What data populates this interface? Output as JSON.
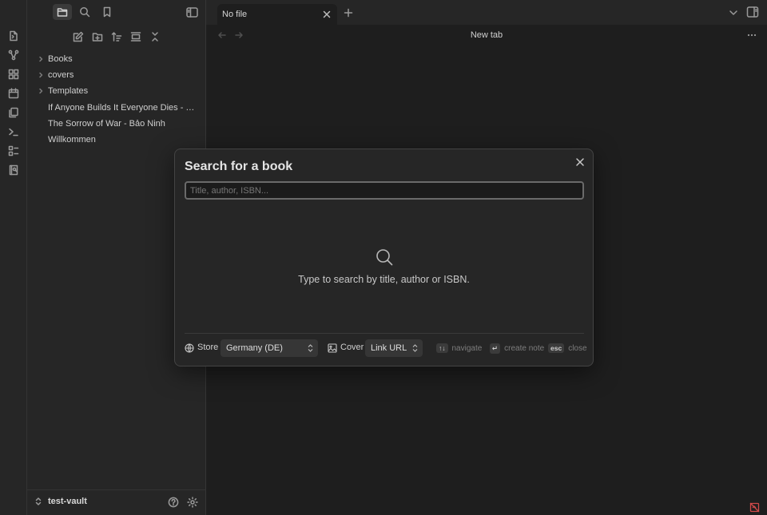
{
  "sidebar": {
    "tree": [
      {
        "label": "Books",
        "type": "folder"
      },
      {
        "label": "covers",
        "type": "folder"
      },
      {
        "label": "Templates",
        "type": "folder"
      },
      {
        "label": "If Anyone Builds It Everyone Dies - Eliezer Yudkowsky",
        "type": "file"
      },
      {
        "label": "The Sorrow of War - Bảo Ninh",
        "type": "file"
      },
      {
        "label": "Willkommen",
        "type": "file"
      }
    ],
    "vault_name": "test-vault"
  },
  "tabs": [
    {
      "label": "No file"
    }
  ],
  "view": {
    "title": "New tab"
  },
  "modal": {
    "title": "Search for a book",
    "search_placeholder": "Title, author, ISBN...",
    "search_value": "",
    "empty_text": "Type to search by title, author or ISBN.",
    "store_label": "Store",
    "store_value": "Germany (DE)",
    "cover_label": "Cover",
    "cover_value": "Link URL",
    "hints": [
      {
        "key": "↑↓",
        "text": "navigate"
      },
      {
        "key": "↵",
        "text": "create note"
      },
      {
        "key": "esc",
        "text": "close"
      }
    ]
  },
  "colors": {
    "background": "#1e1e1e",
    "sidebar": "#262626",
    "status_error": "#d04a4a"
  }
}
